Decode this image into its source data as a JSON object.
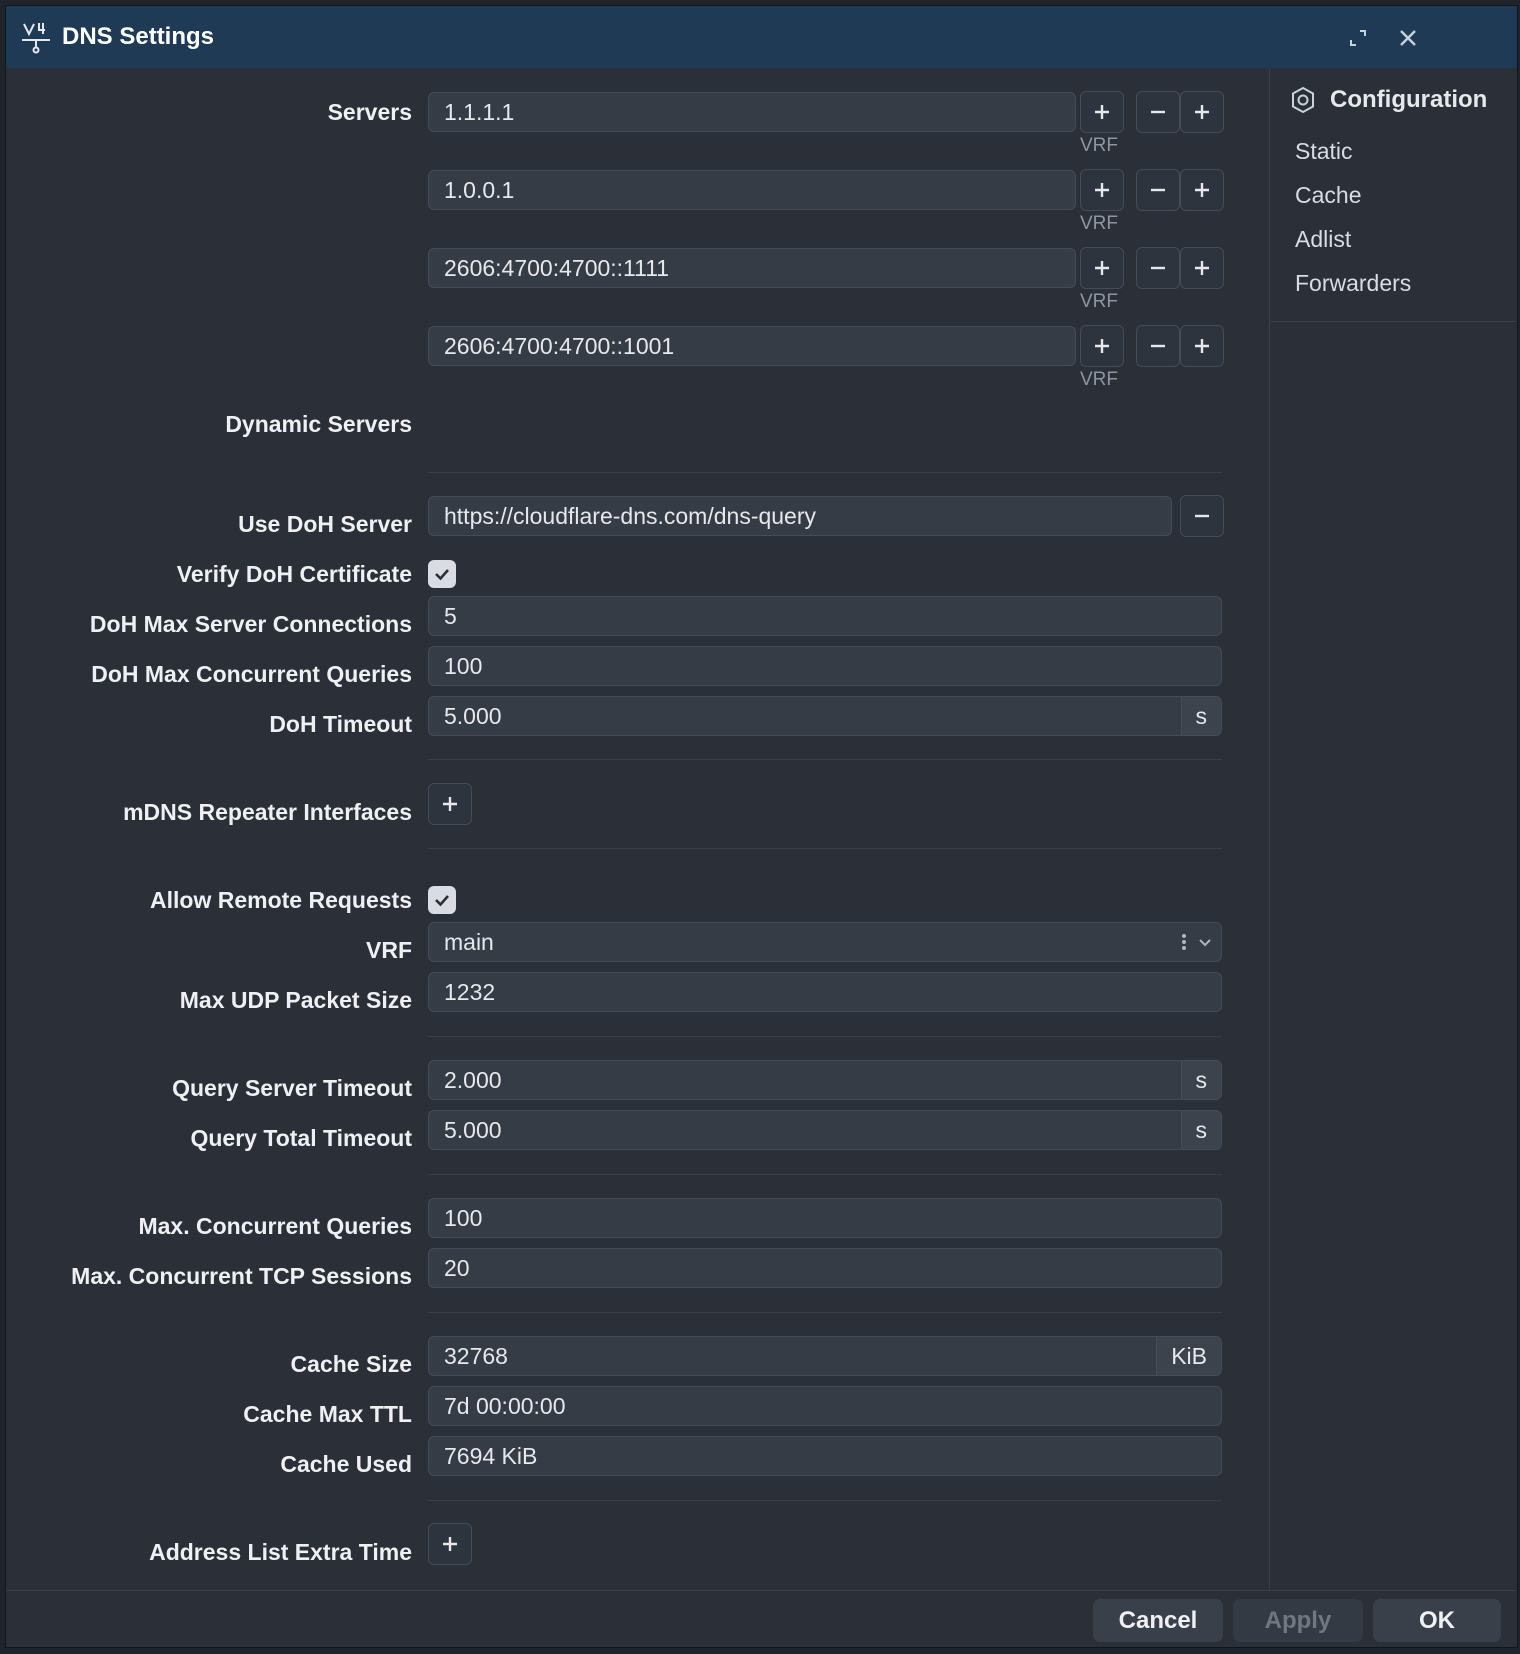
{
  "window": {
    "title": "DNS Settings"
  },
  "sidebar": {
    "heading": "Configuration",
    "items": [
      "Static",
      "Cache",
      "Adlist",
      "Forwarders"
    ]
  },
  "servers": {
    "label": "Servers",
    "rows": [
      {
        "value": "1.1.1.1",
        "tag": "VRF"
      },
      {
        "value": "1.0.0.1",
        "tag": "VRF"
      },
      {
        "value": "2606:4700:4700::1111",
        "tag": "VRF"
      },
      {
        "value": "2606:4700:4700::1001",
        "tag": "VRF"
      }
    ]
  },
  "dynamic_servers": {
    "label": "Dynamic Servers"
  },
  "doh": {
    "server_label": "Use DoH Server",
    "server_value": "https://cloudflare-dns.com/dns-query",
    "verify_label": "Verify DoH Certificate",
    "verify_checked": true,
    "max_conn_label": "DoH Max Server Connections",
    "max_conn_value": "5",
    "max_queries_label": "DoH Max Concurrent Queries",
    "max_queries_value": "100",
    "timeout_label": "DoH Timeout",
    "timeout_value": "5.000",
    "timeout_unit": "s"
  },
  "mdns": {
    "label": "mDNS Repeater Interfaces"
  },
  "remote": {
    "allow_label": "Allow Remote Requests",
    "allow_checked": true,
    "vrf_label": "VRF",
    "vrf_value": "main",
    "udp_label": "Max UDP Packet Size",
    "udp_value": "1232"
  },
  "query": {
    "server_timeout_label": "Query Server Timeout",
    "server_timeout_value": "2.000",
    "server_timeout_unit": "s",
    "total_timeout_label": "Query Total Timeout",
    "total_timeout_value": "5.000",
    "total_timeout_unit": "s"
  },
  "concurrency": {
    "queries_label": "Max. Concurrent Queries",
    "queries_value": "100",
    "tcp_label": "Max. Concurrent TCP Sessions",
    "tcp_value": "20"
  },
  "cache": {
    "size_label": "Cache Size",
    "size_value": "32768",
    "size_unit": "KiB",
    "ttl_label": "Cache Max TTL",
    "ttl_value": "7d 00:00:00",
    "used_label": "Cache Used",
    "used_value": "7694 KiB"
  },
  "address_list": {
    "label": "Address List Extra Time"
  },
  "footer": {
    "cancel": "Cancel",
    "apply": "Apply",
    "ok": "OK"
  }
}
